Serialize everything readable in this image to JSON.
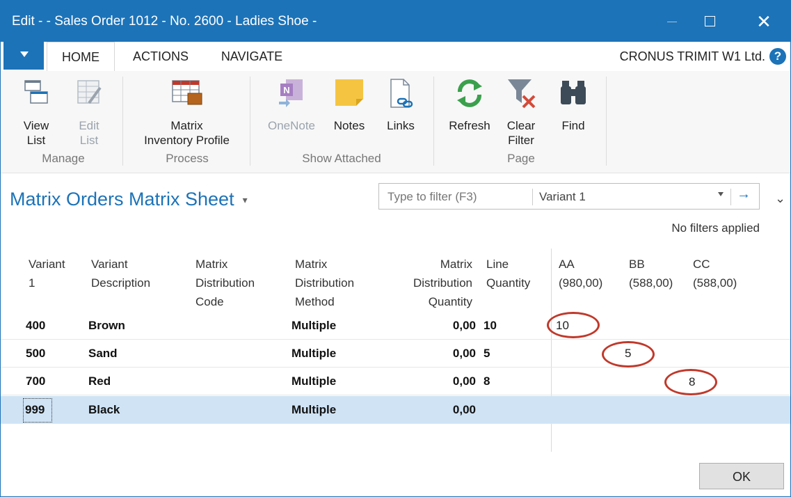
{
  "window": {
    "title": "Edit -  - Sales Order 1012 - No. 2600 - Ladies Shoe -"
  },
  "tabs": [
    "HOME",
    "ACTIONS",
    "NAVIGATE"
  ],
  "company": "CRONUS TRIMIT W1 Ltd.",
  "help": "?",
  "ribbon": {
    "manage": {
      "label": "Manage",
      "view_list": "View\nList",
      "edit_list": "Edit\nList"
    },
    "process": {
      "label": "Process",
      "matrix_inventory_profile": "Matrix\nInventory Profile"
    },
    "show_attached": {
      "label": "Show Attached",
      "onenote": "OneNote",
      "notes": "Notes",
      "links": "Links"
    },
    "page": {
      "label": "Page",
      "refresh": "Refresh",
      "clear_filter": "Clear\nFilter",
      "find": "Find"
    }
  },
  "page_title": "Matrix Orders Matrix Sheet",
  "filter": {
    "placeholder": "Type to filter (F3)",
    "field": "Variant 1"
  },
  "no_filters": "No filters applied",
  "columns": {
    "variant1": "Variant\n1",
    "variant_description": "Variant\nDescription",
    "matrix_distribution_code": "Matrix\nDistribution\nCode",
    "matrix_distribution_method": "Matrix\nDistribution\nMethod",
    "matrix_distribution_quantity": "Matrix\nDistribution\nQuantity",
    "line_quantity": "Line\nQuantity",
    "aa": "AA\n(980,00)",
    "bb": "BB\n(588,00)",
    "cc": "CC\n(588,00)"
  },
  "rows": [
    {
      "variant": "400",
      "description": "Brown",
      "method": "Multiple",
      "dist_qty": "0,00",
      "line_qty": "10",
      "aa": "10",
      "bb": "",
      "cc": ""
    },
    {
      "variant": "500",
      "description": "Sand",
      "method": "Multiple",
      "dist_qty": "0,00",
      "line_qty": "5",
      "aa": "",
      "bb": "5",
      "cc": ""
    },
    {
      "variant": "700",
      "description": "Red",
      "method": "Multiple",
      "dist_qty": "0,00",
      "line_qty": "8",
      "aa": "",
      "bb": "",
      "cc": "8"
    },
    {
      "variant": "999",
      "description": "Black",
      "method": "Multiple",
      "dist_qty": "0,00",
      "line_qty": "",
      "aa": "",
      "bb": "",
      "cc": ""
    }
  ],
  "ok": "OK",
  "colors": {
    "accent": "#1c73b8",
    "selected_row": "#cfe3f5",
    "annotation": "#c0392b"
  }
}
